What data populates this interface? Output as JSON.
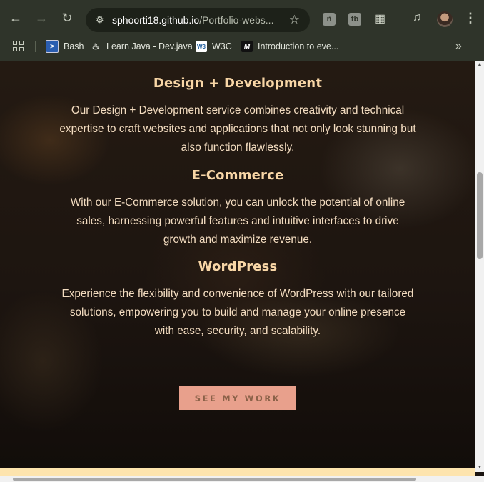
{
  "browser": {
    "url_host": "sphoorti18.github.io",
    "url_path": "/Portfolio-webs...",
    "bookmarks": [
      {
        "label": "Bash",
        "icon": "bash-favicon"
      },
      {
        "label": "Learn Java - Dev.java",
        "icon": "java-favicon"
      },
      {
        "label": "W3C",
        "icon": "w3c-favicon"
      },
      {
        "label": "Introduction to eve...",
        "icon": "medium-favicon"
      }
    ]
  },
  "services": [
    {
      "title": "Design + Development",
      "description": "Our Design + Development service combines creativity and technical expertise to craft websites and applications that not only look stunning but also function flawlessly."
    },
    {
      "title": "E-Commerce",
      "description": "With our E-Commerce solution, you can unlock the potential of online sales, harnessing powerful features and intuitive interfaces to drive growth and maximize revenue."
    },
    {
      "title": "WordPress",
      "description": "Experience the flexibility and convenience of WordPress with our tailored solutions, empowering you to build and manage your online presence with ease, security, and scalability."
    }
  ],
  "cta": {
    "label": "SEE MY WORK"
  },
  "colors": {
    "heading": "#f8d6a6",
    "text": "#f3dcc0",
    "button_bg": "#e8a08c",
    "button_text": "#8a6148",
    "chrome_bg": "#2f342a"
  }
}
